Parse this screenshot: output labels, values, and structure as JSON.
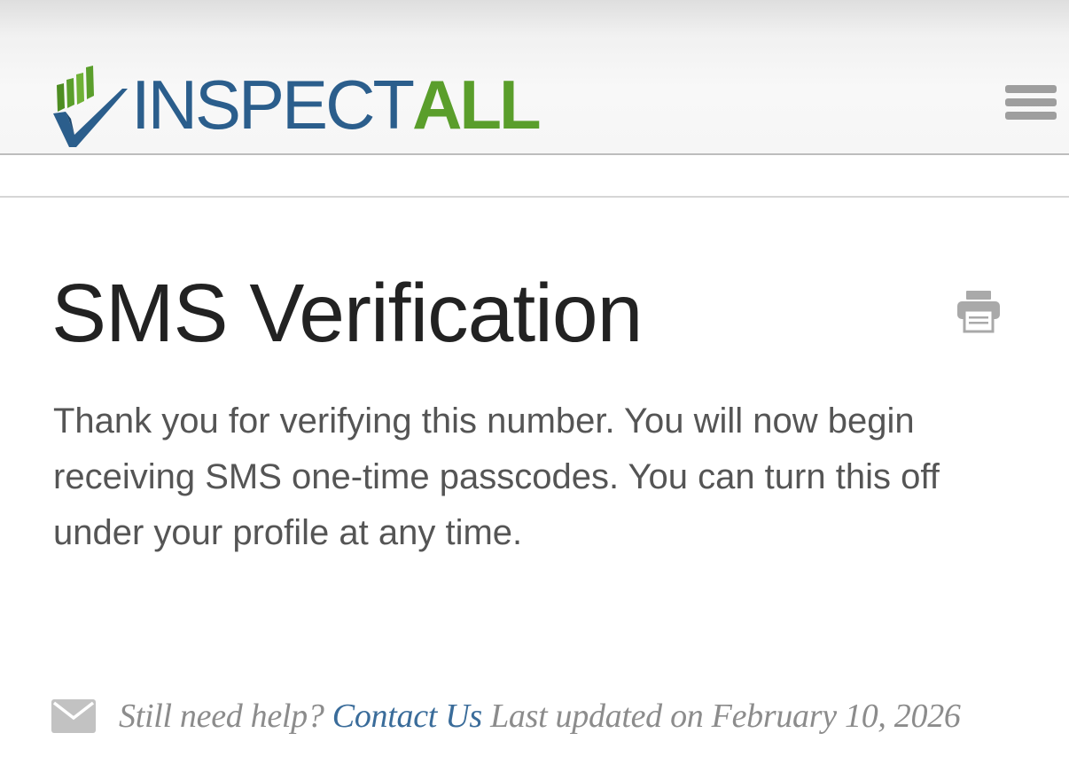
{
  "header": {
    "logo": {
      "text_part1": "INSPECT",
      "text_part2": "ALL",
      "icon": "checkmark-bars-logo",
      "colors": {
        "blue": "#2b5e8c",
        "green": "#5a9e2b"
      }
    },
    "menu_icon": "hamburger-menu-icon"
  },
  "main": {
    "title": "SMS Verification",
    "print_icon": "printer-icon",
    "body": "Thank you for verifying this number. You will now begin receiving SMS one-time passcodes. You can turn this off under your profile at any time."
  },
  "footer": {
    "mail_icon": "envelope-icon",
    "help_prefix": "Still need help?",
    "contact_link": "Contact Us",
    "last_updated_label": "Last updated on",
    "last_updated_date": "February 10, 2026",
    "link_color": "#3a6c9a"
  }
}
